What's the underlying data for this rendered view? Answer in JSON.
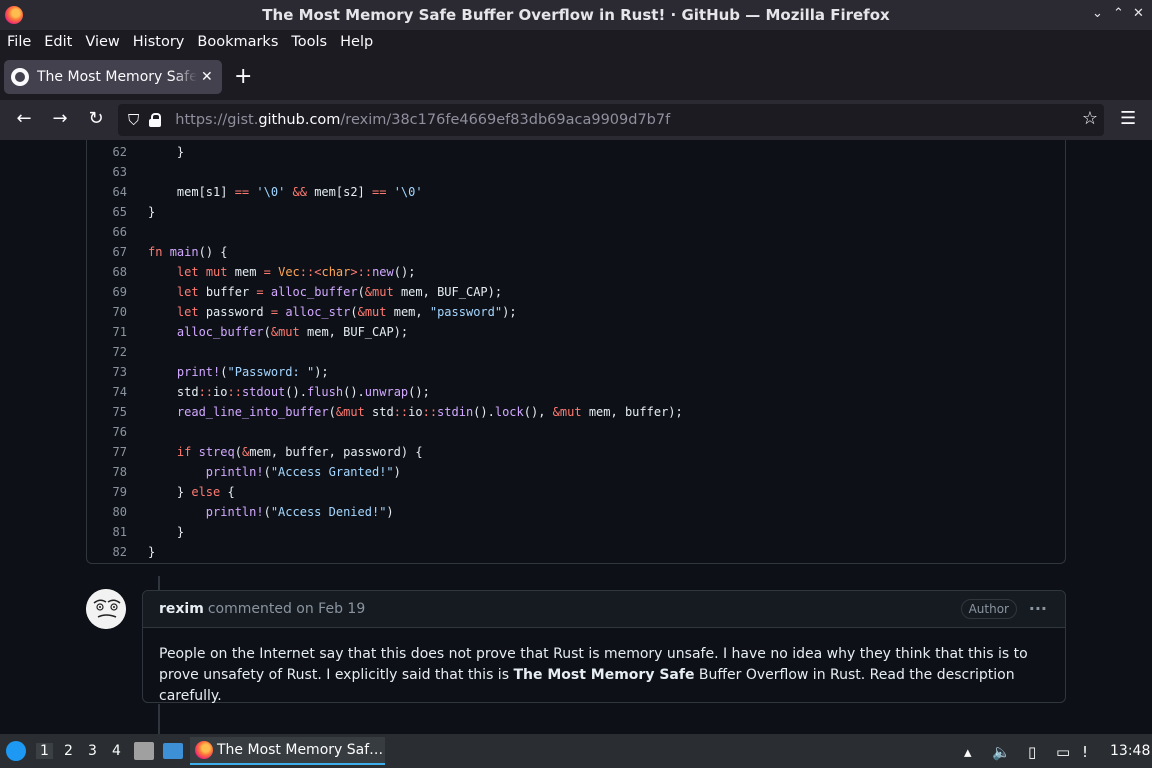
{
  "window": {
    "title": "The Most Memory Safe Buffer Overflow in Rust! · GitHub — Mozilla Firefox",
    "controls": [
      "⌄",
      "⌃",
      "✕"
    ]
  },
  "menu": [
    "File",
    "Edit",
    "View",
    "History",
    "Bookmarks",
    "Tools",
    "Help"
  ],
  "tab": {
    "title": "The Most Memory Safe Buffer Overflow in Rust! · GitHub",
    "close": "✕",
    "new_tab": "+"
  },
  "nav": {
    "back": "←",
    "forward": "→",
    "reload": "↻",
    "url_scheme": "https://gist.",
    "url_host": "github.com",
    "url_path": "/rexim/38c176fe4669ef83db69aca9909d7b7f",
    "star": "☆",
    "menu": "☰"
  },
  "code_lines": [
    {
      "num": "62",
      "html": "    }"
    },
    {
      "num": "63",
      "html": ""
    },
    {
      "num": "64",
      "html": "    mem[s1] <span class=\"op\">==</span> <span class=\"str\">'\\0'</span> <span class=\"op\">&amp;&amp;</span> mem[s2] <span class=\"op\">==</span> <span class=\"str\">'\\0'</span>"
    },
    {
      "num": "65",
      "html": "}"
    },
    {
      "num": "66",
      "html": ""
    },
    {
      "num": "67",
      "html": "<span class=\"kw\">fn</span> <span class=\"fn\">main</span>() {"
    },
    {
      "num": "68",
      "html": "    <span class=\"kw\">let</span> <span class=\"kw\">mut</span> mem <span class=\"op\">=</span> <span class=\"ty\">Vec</span><span class=\"op\">::</span><span class=\"op\">&lt;</span><span class=\"ty\">char</span><span class=\"op\">&gt;::</span><span class=\"fn\">new</span>();"
    },
    {
      "num": "69",
      "html": "    <span class=\"kw\">let</span> buffer <span class=\"op\">=</span> <span class=\"fn\">alloc_buffer</span>(<span class=\"op\">&amp;</span><span class=\"kw\">mut</span> mem, BUF_CAP);"
    },
    {
      "num": "70",
      "html": "    <span class=\"kw\">let</span> password <span class=\"op\">=</span> <span class=\"fn\">alloc_str</span>(<span class=\"op\">&amp;</span><span class=\"kw\">mut</span> mem, <span class=\"str\">\"password\"</span>);"
    },
    {
      "num": "71",
      "html": "    <span class=\"fn\">alloc_buffer</span>(<span class=\"op\">&amp;</span><span class=\"kw\">mut</span> mem, BUF_CAP);"
    },
    {
      "num": "72",
      "html": ""
    },
    {
      "num": "73",
      "html": "    <span class=\"fn\">print!</span>(<span class=\"str\">\"Password: \"</span>);"
    },
    {
      "num": "74",
      "html": "    std<span class=\"op\">::</span>io<span class=\"op\">::</span><span class=\"fn\">stdout</span>().<span class=\"fn\">flush</span>().<span class=\"fn\">unwrap</span>();"
    },
    {
      "num": "75",
      "html": "    <span class=\"fn\">read_line_into_buffer</span>(<span class=\"op\">&amp;</span><span class=\"kw\">mut</span> std<span class=\"op\">::</span>io<span class=\"op\">::</span><span class=\"fn\">stdin</span>().<span class=\"fn\">lock</span>(), <span class=\"op\">&amp;</span><span class=\"kw\">mut</span> mem, buffer);"
    },
    {
      "num": "76",
      "html": ""
    },
    {
      "num": "77",
      "html": "    <span class=\"kw\">if</span> <span class=\"fn\">streq</span>(<span class=\"op\">&amp;</span>mem, buffer, password) {"
    },
    {
      "num": "78",
      "html": "        <span class=\"fn\">println!</span>(<span class=\"str\">\"Access Granted!\"</span>)"
    },
    {
      "num": "79",
      "html": "    } <span class=\"kw\">else</span> {"
    },
    {
      "num": "80",
      "html": "        <span class=\"fn\">println!</span>(<span class=\"str\">\"Access Denied!\"</span>)"
    },
    {
      "num": "81",
      "html": "    }"
    },
    {
      "num": "82",
      "html": "}"
    }
  ],
  "comment": {
    "author": "rexim",
    "meta": "commented on Feb 19",
    "badge": "Author",
    "more": "···",
    "body_part1": "People on the Internet say that this does not prove that Rust is memory unsafe. I have no idea why they think that this is to prove unsafety of Rust. I explicitly said that this is ",
    "body_bold": "The Most Memory Safe",
    "body_part2": " Buffer Overflow in Rust. Read the description carefully."
  },
  "taskbar": {
    "workspaces": [
      "1",
      "2",
      "3",
      "4"
    ],
    "task_label": "The Most Memory Saf…",
    "clock": "13:48"
  }
}
